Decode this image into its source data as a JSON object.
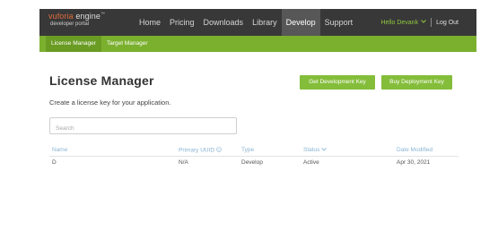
{
  "brand": {
    "name_prefix": "vuforia",
    "name_suffix": " engine",
    "trademark": "™",
    "subtitle": "developer portal"
  },
  "nav": {
    "items": [
      {
        "label": "Home",
        "active": false
      },
      {
        "label": "Pricing",
        "active": false
      },
      {
        "label": "Downloads",
        "active": false
      },
      {
        "label": "Library",
        "active": false
      },
      {
        "label": "Develop",
        "active": true
      },
      {
        "label": "Support",
        "active": false
      }
    ]
  },
  "user": {
    "greeting": "Hello Devank",
    "logout_label": "Log Out"
  },
  "subnav": {
    "items": [
      {
        "label": "License Manager",
        "active": true
      },
      {
        "label": "Target Manager",
        "active": false
      }
    ]
  },
  "main": {
    "title": "License Manager",
    "subtitle": "Create a license key for your application.",
    "get_dev_key_label": "Get Development Key",
    "buy_deploy_key_label": "Buy Deployment Key",
    "search_placeholder": "Search"
  },
  "table": {
    "columns": {
      "name": "Name",
      "uuid": "Primary UUID",
      "type": "Type",
      "status": "Status",
      "date": "Date Modified"
    },
    "rows": [
      {
        "name": "D",
        "uuid": "N/A",
        "type": "Develop",
        "status": "Active",
        "date": "Apr 30, 2021"
      }
    ]
  },
  "colors": {
    "topbar": "#383838",
    "subbar": "#7bb02f",
    "button": "#84bd3a",
    "link": "#8ab4d4"
  }
}
